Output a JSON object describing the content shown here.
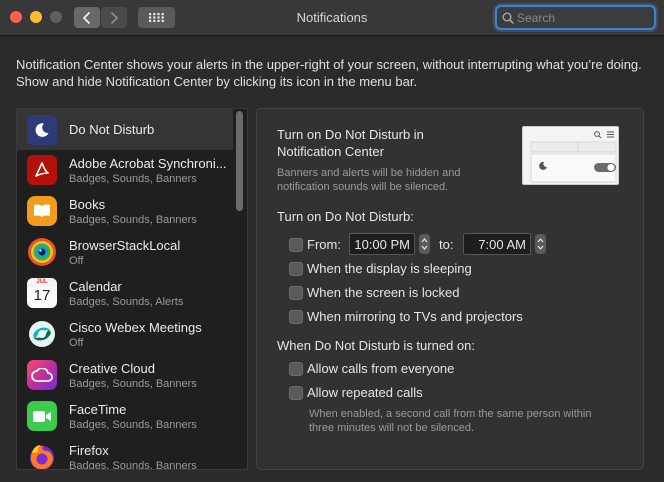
{
  "window": {
    "title": "Notifications",
    "search_placeholder": "Search"
  },
  "description": "Notification Center shows your alerts in the upper-right of your screen, without interrupting what you’re doing. Show and hide Notification Center by clicking its icon in the menu bar.",
  "apps": [
    {
      "name": "Do Not Disturb",
      "sub": "",
      "icon": "moon-icon",
      "selected": true
    },
    {
      "name": "Adobe Acrobat Synchroni...",
      "sub": "Badges, Sounds, Banners",
      "icon": "acrobat-icon"
    },
    {
      "name": "Books",
      "sub": "Badges, Sounds, Banners",
      "icon": "books-icon"
    },
    {
      "name": "BrowserStackLocal",
      "sub": "Off",
      "icon": "browserstack-icon"
    },
    {
      "name": "Calendar",
      "sub": "Badges, Sounds, Alerts",
      "icon": "calendar-icon"
    },
    {
      "name": "Cisco Webex Meetings",
      "sub": "Off",
      "icon": "webex-icon"
    },
    {
      "name": "Creative Cloud",
      "sub": "Badges, Sounds, Banners",
      "icon": "creative-cloud-icon"
    },
    {
      "name": "FaceTime",
      "sub": "Badges, Sounds, Banners",
      "icon": "facetime-icon"
    },
    {
      "name": "Firefox",
      "sub": "Badges, Sounds, Banners",
      "icon": "firefox-icon"
    }
  ],
  "calendar_icon": {
    "month": "JUL",
    "day": "17"
  },
  "dnd": {
    "nc_title": "Turn on Do Not Disturb in Notification Center",
    "nc_line1": "Turn on Do Not Disturb in",
    "nc_line2": "Notification Center",
    "nc_desc_line1": "Banners and alerts will be hidden and",
    "nc_desc_line2": "notification sounds will be silenced.",
    "section1": "Turn on Do Not Disturb:",
    "from_label": "From:",
    "from_value": "10:00 PM",
    "to_label": "to:",
    "to_value": "7:00 AM",
    "options1": [
      {
        "label": "When the display is sleeping",
        "checked": false
      },
      {
        "label": "When the screen is locked",
        "checked": false
      },
      {
        "label": "When mirroring to TVs and projectors",
        "checked": false
      }
    ],
    "section2": "When Do Not Disturb is turned on:",
    "options2": [
      {
        "label": "Allow calls from everyone",
        "checked": false
      },
      {
        "label": "Allow repeated calls",
        "checked": false
      }
    ],
    "repeat_desc_line1": "When enabled, a second call from the same person within",
    "repeat_desc_line2": "three minutes will not be silenced.",
    "from_checked": false
  },
  "colors": {
    "accent": "#3b82d6",
    "background": "#2b2b2b"
  }
}
